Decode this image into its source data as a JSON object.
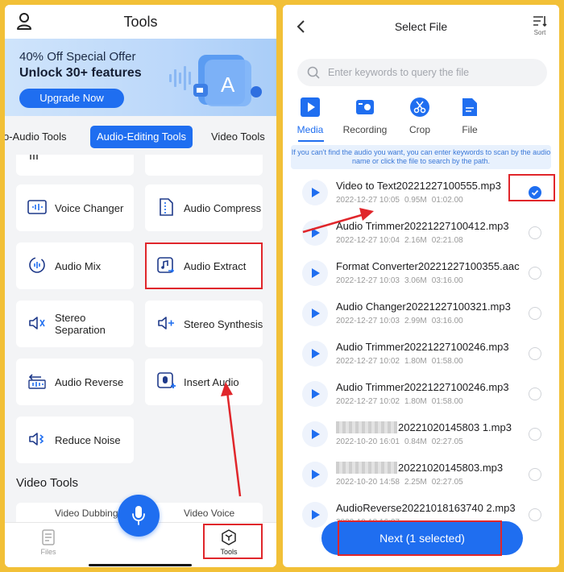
{
  "left": {
    "title": "Tools",
    "banner": {
      "line1": "40% Off Special Offer",
      "line2": "Unlock 30+ features",
      "button": "Upgrade Now"
    },
    "tabs": [
      {
        "label": "o-Audio Tools",
        "active": false
      },
      {
        "label": "Audio-Editing Tools",
        "active": true
      },
      {
        "label": "Video Tools",
        "active": false
      }
    ],
    "tools": [
      {
        "label": "Voice Changer",
        "icon": "voice-changer-icon"
      },
      {
        "label": "Audio Compress",
        "icon": "audio-compress-icon"
      },
      {
        "label": "Audio Mix",
        "icon": "audio-mix-icon"
      },
      {
        "label": "Audio Extract",
        "icon": "audio-extract-icon"
      },
      {
        "label": "Stereo Separation",
        "icon": "stereo-separation-icon"
      },
      {
        "label": "Stereo Synthesis",
        "icon": "stereo-synthesis-icon"
      },
      {
        "label": "Audio Reverse",
        "icon": "audio-reverse-icon"
      },
      {
        "label": "Insert Audio",
        "icon": "insert-audio-icon"
      },
      {
        "label": "Reduce Noise",
        "icon": "reduce-noise-icon"
      }
    ],
    "section_video": "Video Tools",
    "partial_tools": [
      "Video Dubbing",
      "Video Voice"
    ],
    "nav": {
      "files": "Files",
      "tools": "Tools"
    }
  },
  "right": {
    "title": "Select File",
    "sort_label": "Sort",
    "search_placeholder": "Enter keywords to query the file",
    "categories": [
      {
        "label": "Media",
        "active": true
      },
      {
        "label": "Recording",
        "active": false
      },
      {
        "label": "Crop",
        "active": false
      },
      {
        "label": "File",
        "active": false
      }
    ],
    "hint": "If you can't find the audio you want, you can enter keywords to scan by the audio name or click the file to search by the path.",
    "files": [
      {
        "name": "Video to Text20221227100555.mp3",
        "date": "2022-12-27 10:05",
        "size": "0.95M",
        "duration": "01:02.00",
        "selected": true
      },
      {
        "name": "Audio Trimmer20221227100412.mp3",
        "date": "2022-12-27 10:04",
        "size": "2.16M",
        "duration": "02:21.08",
        "selected": false
      },
      {
        "name": "Format Converter20221227100355.aac",
        "date": "2022-12-27 10:03",
        "size": "3.06M",
        "duration": "03:16.00",
        "selected": false
      },
      {
        "name": "Audio Changer20221227100321.mp3",
        "date": "2022-12-27 10:03",
        "size": "2.99M",
        "duration": "03:16.00",
        "selected": false
      },
      {
        "name": "Audio Trimmer20221227100246.mp3",
        "date": "2022-12-27 10:02",
        "size": "1.80M",
        "duration": "01:58.00",
        "selected": false
      },
      {
        "name": "Audio Trimmer20221227100246.mp3",
        "date": "2022-12-27 10:02",
        "size": "1.80M",
        "duration": "01:58.00",
        "selected": false
      },
      {
        "name": "20221020145803 1.mp3",
        "name_visible": "20221020145803 1.mp3",
        "date": "2022-10-20 16:01",
        "size": "0.84M",
        "duration": "02:27.05",
        "selected": false,
        "blurred_prefix": true
      },
      {
        "name": "20221020145803.mp3",
        "name_visible": "20221020145803.mp3",
        "date": "2022-10-20 14:58",
        "size": "2.25M",
        "duration": "02:27.05",
        "selected": false,
        "blurred_prefix": true
      },
      {
        "name": "AudioReverse20221018163740 2.mp3",
        "date": "2022-10-18 16:37",
        "size": "",
        "duration": "",
        "selected": false
      }
    ],
    "next_button": "Next (1 selected)"
  },
  "colors": {
    "accent": "#1f6ef0",
    "frame": "#f2c037",
    "highlight": "#e0262b"
  }
}
